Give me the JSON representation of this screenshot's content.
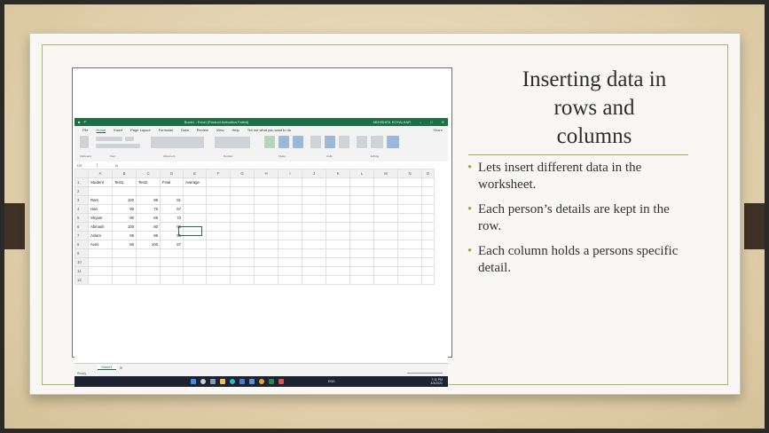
{
  "slide": {
    "title_lines": [
      "Inserting data in",
      "rows and",
      "columns"
    ],
    "bullets": [
      "Lets insert different data in the worksheet.",
      "Each person’s details are kept in the row.",
      "Each column holds a persons specific detail."
    ],
    "bullet_glyph": "•",
    "accent_color": "#9bb14f"
  },
  "excel": {
    "title": "Book1 - Excel (Product Activation Failed)",
    "account": "ABHISHEK KOYALKAR",
    "menu": [
      "File",
      "Home",
      "Insert",
      "Page Layout",
      "Formulas",
      "Data",
      "Review",
      "View",
      "Help",
      "Tell me what you want to do"
    ],
    "share": "Share",
    "ribbon_groups": [
      "Clipboard",
      "Font",
      "Alignment",
      "Number",
      "Styles",
      "Cells",
      "Editing"
    ],
    "name_box": "D9",
    "fx": "fx",
    "columns": [
      "A",
      "B",
      "C",
      "D",
      "E",
      "F",
      "G",
      "H",
      "I",
      "J",
      "K",
      "L",
      "M",
      "N",
      "O"
    ],
    "rows": [
      {
        "n": "1",
        "cells": [
          "Student",
          "Test1",
          "Test2",
          "Final",
          "Average"
        ]
      },
      {
        "n": "2",
        "cells": [
          "",
          "",
          "",
          "",
          ""
        ]
      },
      {
        "n": "3",
        "cells": [
          "Ram",
          "100",
          "98",
          "81",
          ""
        ]
      },
      {
        "n": "4",
        "cells": [
          "Hari",
          "90",
          "76",
          "67",
          ""
        ]
      },
      {
        "n": "5",
        "cells": [
          "Shyam",
          "90",
          "69",
          "73",
          ""
        ]
      },
      {
        "n": "6",
        "cells": [
          "Abinash",
          "100",
          "80",
          "95",
          ""
        ]
      },
      {
        "n": "7",
        "cells": [
          "Aslam",
          "95",
          "98",
          "95",
          ""
        ]
      },
      {
        "n": "8",
        "cells": [
          "Avnit",
          "80",
          "100",
          "87",
          ""
        ]
      },
      {
        "n": "9",
        "cells": [
          "",
          "",
          "",
          "",
          ""
        ]
      },
      {
        "n": "10",
        "cells": [
          "",
          "",
          "",
          "",
          ""
        ]
      },
      {
        "n": "11",
        "cells": [
          "",
          "",
          "",
          "",
          ""
        ]
      },
      {
        "n": "12",
        "cells": [
          "",
          "",
          "",
          "",
          ""
        ]
      }
    ],
    "sheet_tab": "Sheet1",
    "status": "Ready",
    "clock_time": "7:11 PM",
    "clock_date": "4/3/2021",
    "lang": "ENG"
  }
}
